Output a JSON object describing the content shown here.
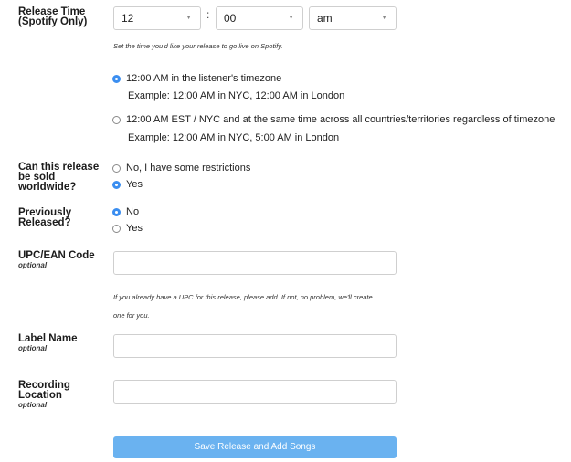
{
  "release_time": {
    "label_line1": "Release Time",
    "label_line2": "(Spotify Only)",
    "hour": "12",
    "minute": "00",
    "ampm": "am",
    "colon": ":",
    "arrow_glyph": "▼",
    "help": "Set the time you'd like your release to go live on Spotify.",
    "options": [
      {
        "label": "12:00 AM in the listener's timezone",
        "example": "Example: 12:00 AM in NYC, 12:00 AM in London",
        "selected": true
      },
      {
        "label": "12:00 AM EST / NYC and at the same time across all countries/territories regardless of timezone",
        "example": "Example: 12:00 AM in NYC, 5:00 AM in London",
        "selected": false
      }
    ]
  },
  "worldwide": {
    "label_line1": "Can this release",
    "label_line2": "be sold",
    "label_line3": "worldwide?",
    "options": [
      {
        "label": "No, I have some restrictions",
        "selected": false
      },
      {
        "label": "Yes",
        "selected": true
      }
    ]
  },
  "previously_released": {
    "label_line1": "Previously",
    "label_line2": "Released?",
    "options": [
      {
        "label": "No",
        "selected": true
      },
      {
        "label": "Yes",
        "selected": false
      }
    ]
  },
  "upc": {
    "label": "UPC/EAN Code",
    "optional": "optional",
    "value": "",
    "help_line1": "If you already have a UPC for this release, please add. If not, no problem, we'll create",
    "help_line2": "one for you."
  },
  "label_name": {
    "label": "Label Name",
    "optional": "optional",
    "value": ""
  },
  "recording_location": {
    "label_line1": "Recording",
    "label_line2": "Location",
    "optional": "optional",
    "value": ""
  },
  "save_button": "Save Release and Add Songs",
  "colors": {
    "accent": "#3b8ef0",
    "button": "#6ab2f0",
    "border": "#cfcfcf"
  }
}
